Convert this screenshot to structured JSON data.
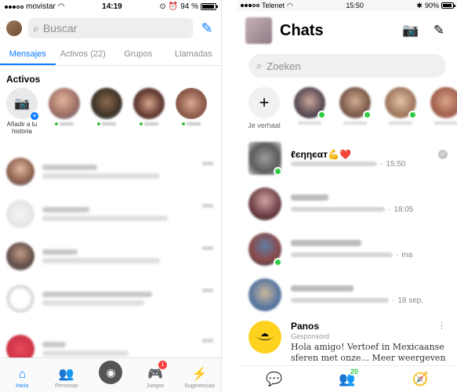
{
  "left": {
    "status": {
      "carrier": "movistar",
      "time": "14:19",
      "battery": "94 %",
      "battery_level": 0.94
    },
    "search_placeholder": "Buscar",
    "tabs": [
      {
        "label": "Mensajes",
        "active": true
      },
      {
        "label": "Activos (22)",
        "active": false
      },
      {
        "label": "Grupos",
        "active": false
      },
      {
        "label": "Llamadas",
        "active": false
      }
    ],
    "active_heading": "Activos",
    "add_story_label": "Añadir a tu historia",
    "tabbar": [
      {
        "label": "Inicio",
        "icon": "home-icon"
      },
      {
        "label": "Personas",
        "icon": "people-icon"
      },
      {
        "label": "",
        "icon": "camera-icon"
      },
      {
        "label": "Juegos",
        "icon": "games-icon",
        "badge": "1"
      },
      {
        "label": "Sugerencias",
        "icon": "lightning-icon"
      }
    ]
  },
  "right": {
    "status": {
      "carrier": "Telenet",
      "time": "15:50",
      "battery": "90%",
      "battery_level": 0.9
    },
    "title": "Chats",
    "search_placeholder": "Zoeken",
    "add_story_label": "Je verhaal",
    "chats": [
      {
        "name": "ℓєηηєαт💪❤️",
        "time": "15:50"
      },
      {
        "name": "",
        "time": "18:05"
      },
      {
        "name": "",
        "time": "ma"
      },
      {
        "name": "",
        "time": "18 sep."
      }
    ],
    "ad": {
      "name": "Panos",
      "sponsored": "Gesponsord",
      "message": "Hola amigo! Vertoef in Mexicaanse sferen met onze... Meer weergeven"
    },
    "tabbar_badge": "20"
  },
  "colors": {
    "messenger_blue": "#0a7cff",
    "online_green": "#31cc46",
    "badge_red": "#fa3e3e",
    "ad_yellow": "#ffd21f"
  }
}
